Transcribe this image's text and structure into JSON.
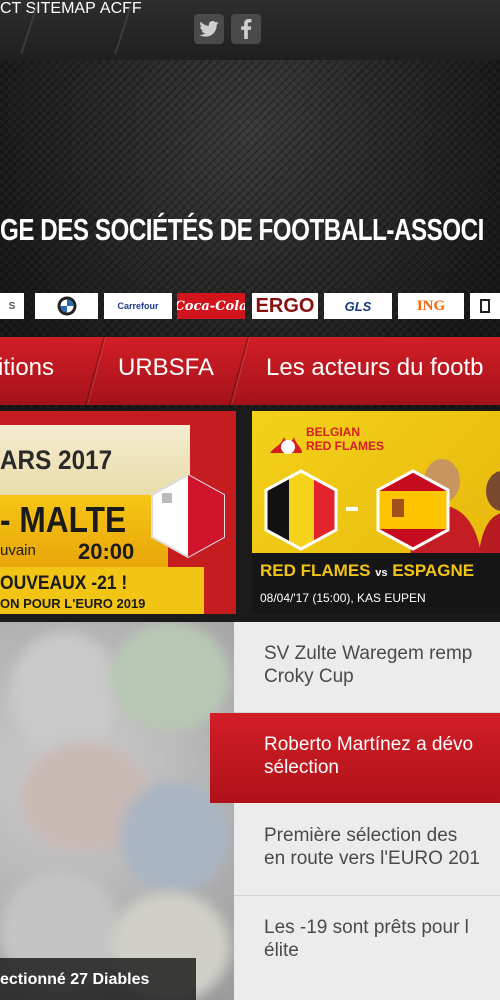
{
  "topnav": {
    "items": [
      "CT",
      "SITEMAP",
      "ACFF"
    ],
    "social": [
      "twitter-icon",
      "facebook-icon"
    ]
  },
  "header": {
    "title": "GE DES SOCIÉTÉS DE FOOTBALL-ASSOCI",
    "sponsors": [
      "BMW",
      "Carrefour",
      "Coca-Cola",
      "ERGO",
      "GLS",
      "ING"
    ]
  },
  "mainnav": {
    "items": [
      "itions",
      "URBSFA",
      "Les acteurs du footb"
    ]
  },
  "banner_left": {
    "date": "ARS 2017",
    "match": "- MALTE",
    "venue": "uvain",
    "time": "20:00",
    "headline": "OUVEAUX -21 !",
    "subline": "ON POUR L'EURO 2019"
  },
  "banner_right": {
    "brand_line1": "BELGIAN",
    "brand_line2": "RED FLAMES",
    "title_a": "RED FLAMES",
    "title_vs": "vs",
    "title_b": "ESPAGNE",
    "details": "08/04/'17 (15:00), KAS EUPEN"
  },
  "photo_caption": "ectionné 27 Diables",
  "news": [
    {
      "line1": "SV Zulte Waregem remp",
      "line2": "Croky Cup",
      "active": false
    },
    {
      "line1": "Roberto Martínez a dévo",
      "line2": "sélection",
      "active": true
    },
    {
      "line1": "Première sélection des",
      "line2": "en route vers l'EURO 201",
      "active": false
    },
    {
      "line1": "Les -19 sont prêts pour l",
      "line2": "élite",
      "active": false
    }
  ],
  "colors": {
    "accent_red": "#d21e26",
    "dark_bg": "#1b1b1b",
    "yellow": "#f2c515"
  }
}
